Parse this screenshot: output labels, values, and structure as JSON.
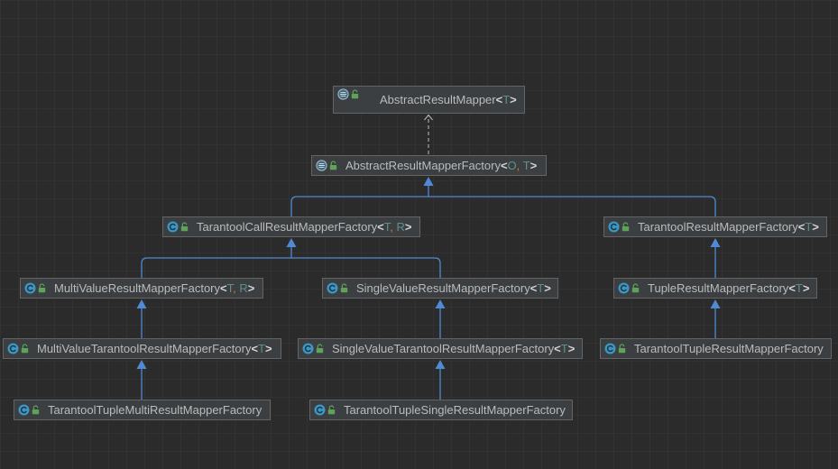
{
  "colors": {
    "background": "#2b2b2b",
    "grid": "#323232",
    "node_fill": "#3c3f41",
    "node_border": "#646464",
    "text": "#bbbbbb",
    "type_param": "#5f8f86",
    "bracket": "#d4d4d4",
    "comma": "#cc7832",
    "extends_edge": "#4f8ad3",
    "implements_edge": "#bdbdbd",
    "class_icon": "#3d97c4",
    "public_icon": "#5fa35a"
  },
  "nodes": [
    {
      "label": "AbstractResultMapper<T>",
      "icon": "abstract-class-icon",
      "visibility_icon": "public-lock-icon"
    },
    {
      "label": "AbstractResultMapperFactory<O, T>",
      "icon": "abstract-class-icon",
      "visibility_icon": "public-lock-icon"
    },
    {
      "label": "TarantoolCallResultMapperFactory<T, R>",
      "icon": "class-icon",
      "visibility_icon": "public-lock-icon"
    },
    {
      "label": "TarantoolResultMapperFactory<T>",
      "icon": "class-icon",
      "visibility_icon": "public-lock-icon"
    },
    {
      "label": "MultiValueResultMapperFactory<T, R>",
      "icon": "class-icon",
      "visibility_icon": "public-lock-icon"
    },
    {
      "label": "SingleValueResultMapperFactory<T>",
      "icon": "class-icon",
      "visibility_icon": "public-lock-icon"
    },
    {
      "label": "TupleResultMapperFactory<T>",
      "icon": "class-icon",
      "visibility_icon": "public-lock-icon"
    },
    {
      "label": "MultiValueTarantoolResultMapperFactory<T>",
      "icon": "class-icon",
      "visibility_icon": "public-lock-icon"
    },
    {
      "label": "SingleValueTarantoolResultMapperFactory<T>",
      "icon": "class-icon",
      "visibility_icon": "public-lock-icon"
    },
    {
      "label": "TarantoolTupleResultMapperFactory",
      "icon": "class-icon",
      "visibility_icon": "public-lock-icon"
    },
    {
      "label": "TarantoolTupleMultiResultMapperFactory",
      "icon": "class-icon",
      "visibility_icon": "public-lock-icon"
    },
    {
      "label": "TarantoolTupleSingleResultMapperFactory",
      "icon": "class-icon",
      "visibility_icon": "public-lock-icon"
    }
  ]
}
